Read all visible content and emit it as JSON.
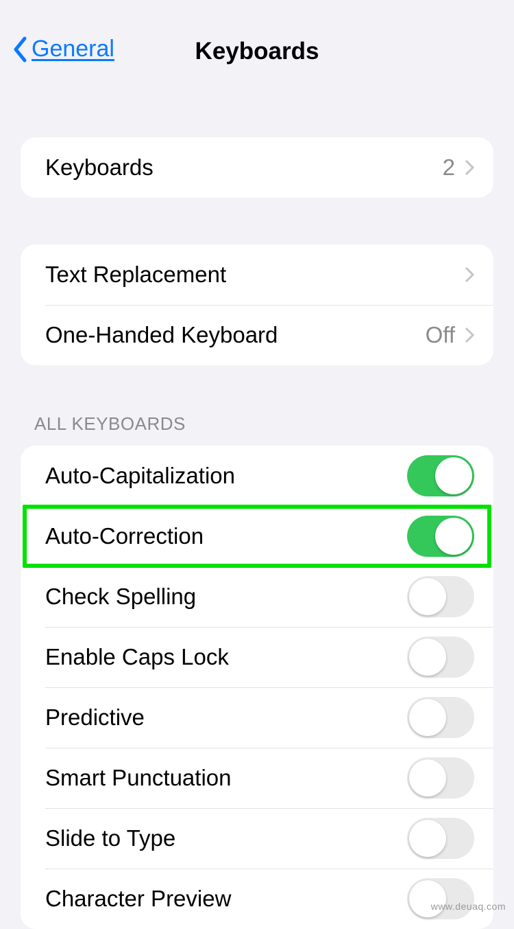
{
  "nav": {
    "back_label": "General",
    "title": "Keyboards"
  },
  "group1": {
    "keyboards_label": "Keyboards",
    "keyboards_count": "2"
  },
  "group2": {
    "text_replacement": "Text Replacement",
    "one_handed": "One-Handed Keyboard",
    "one_handed_value": "Off"
  },
  "section_header": "All Keyboards",
  "toggles": {
    "auto_cap": {
      "label": "Auto-Capitalization",
      "on": true
    },
    "auto_corr": {
      "label": "Auto-Correction",
      "on": true
    },
    "check_spell": {
      "label": "Check Spelling",
      "on": false
    },
    "caps_lock": {
      "label": "Enable Caps Lock",
      "on": false
    },
    "predictive": {
      "label": "Predictive",
      "on": false
    },
    "smart_punct": {
      "label": "Smart Punctuation",
      "on": false
    },
    "slide_type": {
      "label": "Slide to Type",
      "on": false
    },
    "char_prev": {
      "label": "Character Preview",
      "on": false
    }
  },
  "highlight_row": "auto_corr",
  "attribution": "www.deuaq.com"
}
